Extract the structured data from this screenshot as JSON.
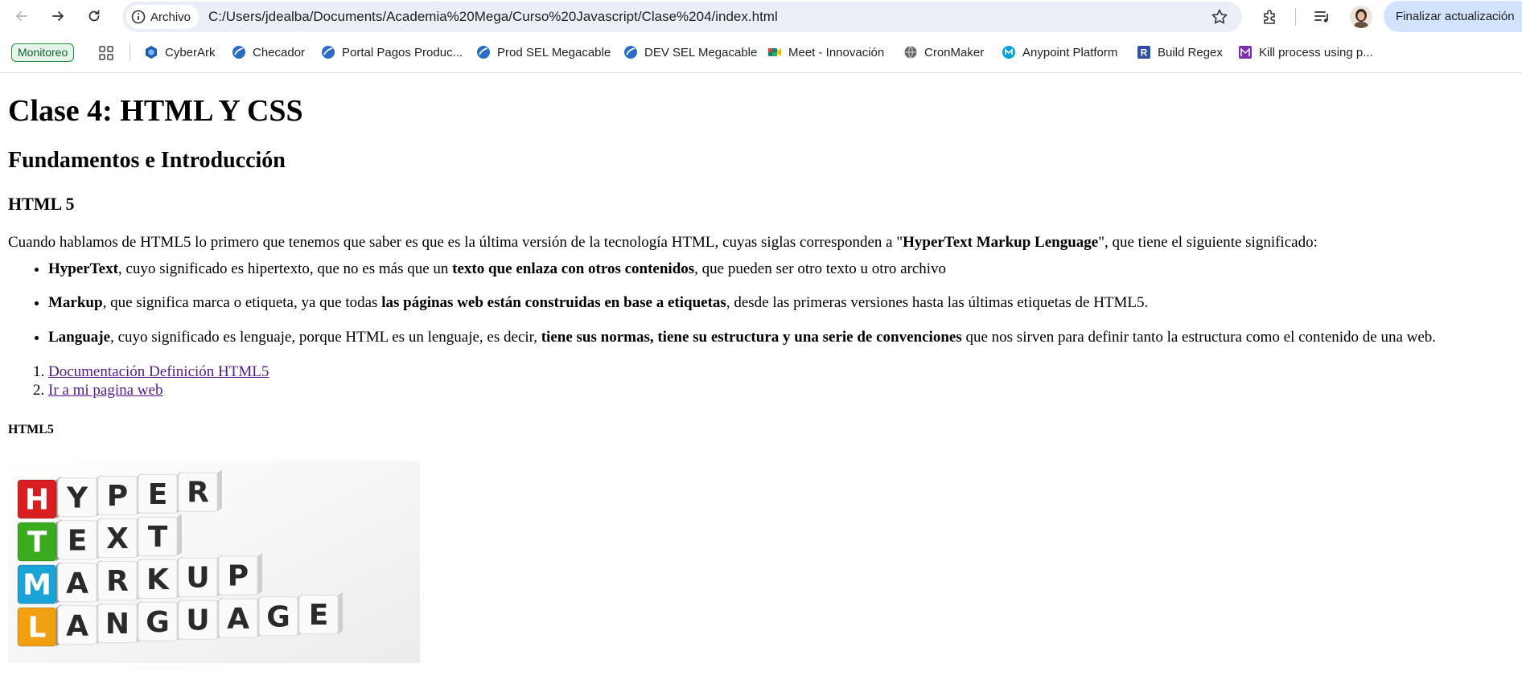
{
  "browser": {
    "url_chip": "Archivo",
    "url": "C:/Users/jdealba/Documents/Academia%20Mega/Curso%20Javascript/Clase%204/index.html",
    "update_button": "Finalizar actualización"
  },
  "bookmarks": {
    "monitoreo": "Monitoreo",
    "items": [
      {
        "label": "CyberArk",
        "icon": "cyberark-icon"
      },
      {
        "label": "Checador",
        "icon": "globe-icon"
      },
      {
        "label": "Portal Pagos Produc...",
        "icon": "globe-icon"
      },
      {
        "label": "Prod SEL Megacable",
        "icon": "globe-icon"
      },
      {
        "label": "DEV SEL Megacable",
        "icon": "globe-icon"
      },
      {
        "label": "Meet - Innovación",
        "icon": "meet-icon"
      },
      {
        "label": "CronMaker",
        "icon": "globe-icon"
      },
      {
        "label": "Anypoint Platform",
        "icon": "mulesoft-icon"
      },
      {
        "label": "Build Regex",
        "icon": "regex-icon"
      },
      {
        "label": "Kill process using p...",
        "icon": "kill-process-icon"
      }
    ]
  },
  "page": {
    "h1": "Clase 4: HTML Y CSS",
    "h2": "Fundamentos e Introducción",
    "h3": "HTML 5",
    "intro": {
      "before": "Cuando hablamos de HTML5 lo primero que tenemos que saber es que es la última versión de la tecnología HTML, cuyas siglas corresponden a \"",
      "strong": "HyperText Markup Lenguage",
      "after": "\", que tiene el siguiente significado:"
    },
    "bullets": [
      {
        "term": "HyperText",
        "text1": ", cuyo significado es hipertexto, que no es más que un ",
        "strong": "texto que enlaza con otros contenidos",
        "text2": ", que pueden ser otro texto u otro archivo"
      },
      {
        "term": "Markup",
        "text1": ", que significa marca o etiqueta, ya que todas ",
        "strong": "las páginas web están construidas en base a etiquetas",
        "text2": ", desde las primeras versiones hasta las últimas etiquetas de HTML5."
      },
      {
        "term": "Languaje",
        "text1": ", cuyo significado es lenguaje, porque HTML es un lenguaje, es decir, ",
        "strong": "tiene sus normas, tiene su estructura y una serie de convenciones",
        "text2": " que nos sirven para definir tanto la estructura como el contenido de una web."
      }
    ],
    "links": [
      "Documentación Definición HTML5",
      "Ir a mi pagina web"
    ],
    "h5": "HTML5",
    "image": {
      "rows": [
        {
          "letter": "H",
          "rest": "YPER",
          "color": "#d81e1e"
        },
        {
          "letter": "T",
          "rest": "EXT",
          "color": "#3aaa1e"
        },
        {
          "letter": "M",
          "rest": "ARKUP",
          "color": "#1aa3d9"
        },
        {
          "letter": "L",
          "rest": "ANGUAGE",
          "color": "#f0a010"
        }
      ]
    }
  }
}
